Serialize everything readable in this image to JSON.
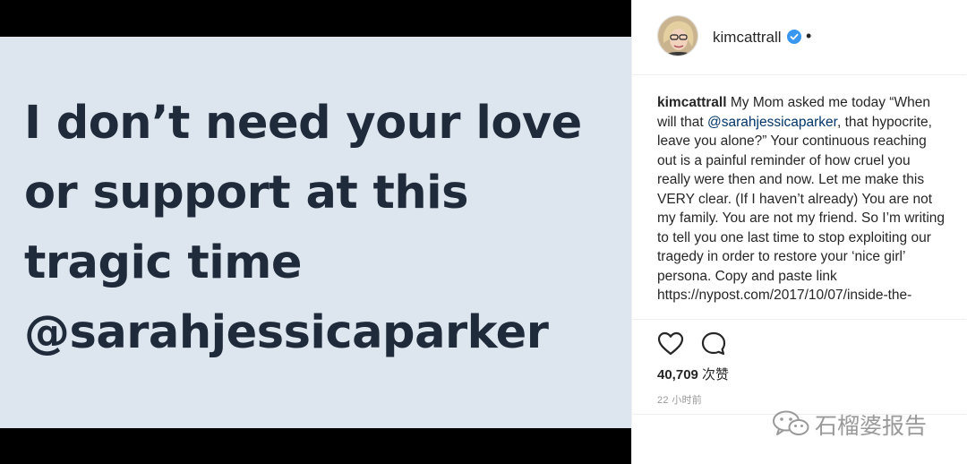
{
  "media": {
    "quote": "I don’t need your love\nor support at this\ntragic time\n@sarahjessicaparker"
  },
  "post": {
    "username": "kimcattrall",
    "dot": "•",
    "caption": {
      "user": "kimcattrall",
      "text_before_mention": " My Mom asked me today “When will that ",
      "mention": "@sarahjessicaparker",
      "text_after_mention": ", that hypocrite, leave you alone?” Your continuous reaching out is a painful reminder of how cruel you really were then and now. Let me make this VERY clear. (If I haven’t already) You are not my family. You are not my friend. So I’m writing to tell you one last time to stop exploiting our tragedy in order to restore your ‘nice girl’ persona. Copy and paste link https://nypost.com/2017/10/07/inside-the-"
    },
    "likes_count": "40,709",
    "likes_suffix": " 次赞",
    "timestamp": "22 小时前"
  },
  "icons": {
    "avatar": "avatar",
    "verified": "verified-badge-icon",
    "like": "heart-icon",
    "comment": "comment-bubble-icon",
    "watermark": "wechat-icon"
  },
  "watermark": {
    "text": "石榴婆报告"
  },
  "colors": {
    "mention": "#003569",
    "verified": "#3897f0",
    "quote": "#1f2a3a",
    "card": "#dde6ee"
  }
}
